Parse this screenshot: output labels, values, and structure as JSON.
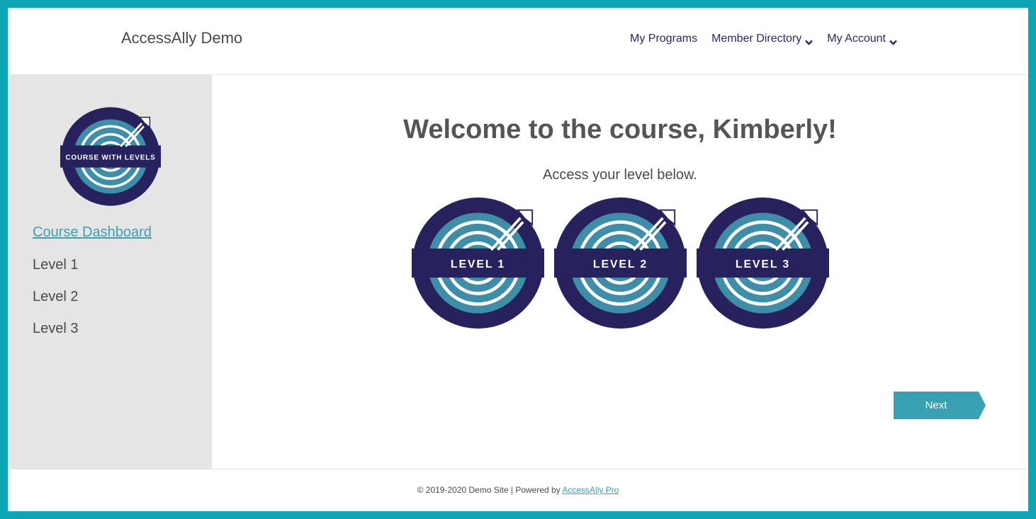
{
  "header": {
    "site_title": "AccessAlly Demo",
    "nav": [
      {
        "label": "My Programs",
        "dropdown": false
      },
      {
        "label": "Member Directory",
        "dropdown": true
      },
      {
        "label": "My Account",
        "dropdown": true
      }
    ]
  },
  "sidebar": {
    "badge_text": "COURSE WITH LEVELS",
    "links": [
      {
        "label": "Course Dashboard",
        "active": true
      },
      {
        "label": "Level 1",
        "active": false
      },
      {
        "label": "Level 2",
        "active": false
      },
      {
        "label": "Level 3",
        "active": false
      }
    ]
  },
  "main": {
    "title": "Welcome to the course, Kimberly!",
    "subtitle": "Access your level below.",
    "levels": [
      "LEVEL 1",
      "LEVEL 2",
      "LEVEL 3"
    ],
    "next_label": "Next"
  },
  "footer": {
    "text": "© 2019-2020 Demo Site | Powered by ",
    "link_label": "AccessAlly Pro"
  },
  "colors": {
    "frame": "#0ba5b4",
    "badge_navy": "#27215e",
    "badge_teal": "#3d8ea6",
    "accent": "#3aa1b2",
    "button": "#3aa1b2"
  },
  "icons": {
    "dropdown": "chevron-down-icon",
    "badge": "target-arrow-icon"
  }
}
